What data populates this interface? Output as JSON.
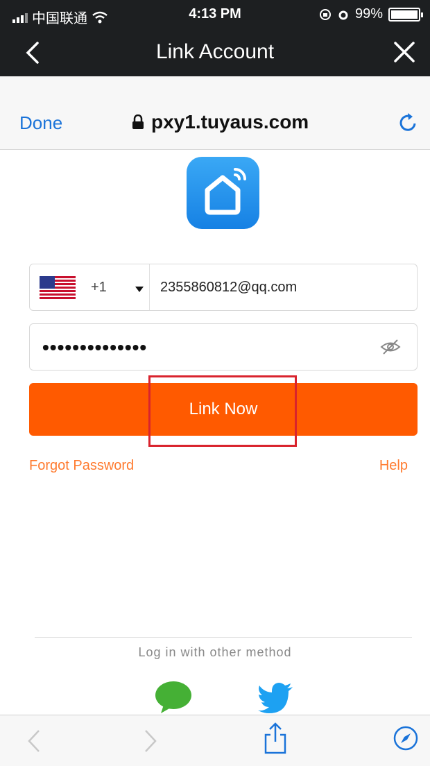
{
  "status_bar": {
    "carrier": "中国联通",
    "time": "4:13 PM",
    "battery": "99%",
    "battery_level": 0.99
  },
  "nav": {
    "title": "Link Account",
    "back_icon": "chevron-left-icon",
    "close_icon": "close-icon"
  },
  "browser": {
    "done_label": "Done",
    "url": "pxy1.tuyaus.com",
    "lock_icon": "lock-icon",
    "reload_icon": "reload-icon"
  },
  "app_icon": "smart-home-app-icon",
  "form": {
    "country_flag": "us-flag-icon",
    "country_code": "+1",
    "account_value": "2355860812@qq.com",
    "password_value": "••••••••••••••",
    "eye_icon": "eye-hidden-icon",
    "link_button_label": "Link Now",
    "forgot_label": "Forgot Password",
    "help_label": "Help"
  },
  "other_login": {
    "label": "Log in with other method",
    "methods": [
      "wechat-icon",
      "twitter-icon"
    ]
  },
  "toolbar": {
    "icons": [
      "back-arrow-icon",
      "forward-arrow-icon",
      "share-icon",
      "compass-icon"
    ]
  },
  "colors": {
    "accent_orange": "#ff5a00",
    "link_orange": "#ff7a2e",
    "ios_blue": "#1a73d9",
    "highlight_red": "#d9232d",
    "dark_bar": "#1d1f21"
  }
}
